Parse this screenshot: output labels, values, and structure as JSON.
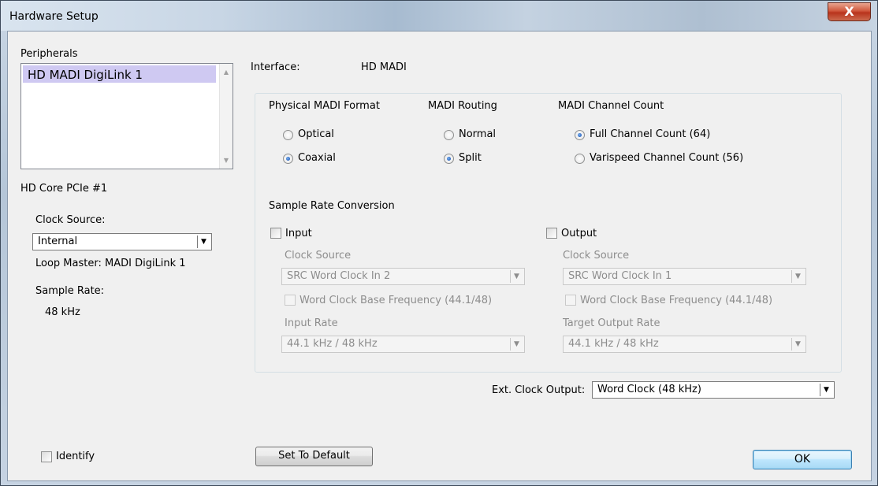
{
  "window": {
    "title": "Hardware Setup",
    "close_glyph": "X"
  },
  "peripherals": {
    "label": "Peripherals",
    "items": [
      "HD MADI DigiLink 1"
    ]
  },
  "core": {
    "name": "HD Core PCIe #1",
    "clock_source_label": "Clock Source:",
    "clock_source_value": "Internal",
    "loop_master": "Loop Master: MADI DigiLink 1",
    "sample_rate_label": "Sample Rate:",
    "sample_rate_value": "48 kHz"
  },
  "interface": {
    "label": "Interface:",
    "value": "HD MADI"
  },
  "physical_format": {
    "heading": "Physical MADI Format",
    "options": [
      {
        "label": "Optical",
        "checked": false
      },
      {
        "label": "Coaxial",
        "checked": true
      }
    ]
  },
  "routing": {
    "heading": "MADI Routing",
    "options": [
      {
        "label": "Normal",
        "checked": false
      },
      {
        "label": "Split",
        "checked": true
      }
    ]
  },
  "channel_count": {
    "heading": "MADI Channel Count",
    "options": [
      {
        "label": "Full Channel Count (64)",
        "checked": true
      },
      {
        "label": "Varispeed Channel Count (56)",
        "checked": false
      }
    ]
  },
  "src": {
    "heading": "Sample Rate Conversion",
    "input": {
      "label": "Input",
      "checked": false,
      "clock_source_label": "Clock Source",
      "clock_source_value": "SRC Word Clock In 2",
      "wordclock_label": "Word Clock Base Frequency (44.1/48)",
      "rate_label": "Input Rate",
      "rate_value": "44.1 kHz / 48 kHz"
    },
    "output": {
      "label": "Output",
      "checked": false,
      "clock_source_label": "Clock Source",
      "clock_source_value": "SRC Word Clock In 1",
      "wordclock_label": "Word Clock Base Frequency (44.1/48)",
      "rate_label": "Target Output Rate",
      "rate_value": "44.1 kHz / 48 kHz"
    }
  },
  "ext_clock": {
    "label": "Ext. Clock Output:",
    "value": "Word Clock (48 kHz)"
  },
  "footer": {
    "identify_label": "Identify",
    "set_default_label": "Set To Default",
    "ok_label": "OK"
  },
  "colors": {
    "accent": "#1c58b8",
    "selection": "#cfc9f2",
    "close": "#c9462c"
  }
}
